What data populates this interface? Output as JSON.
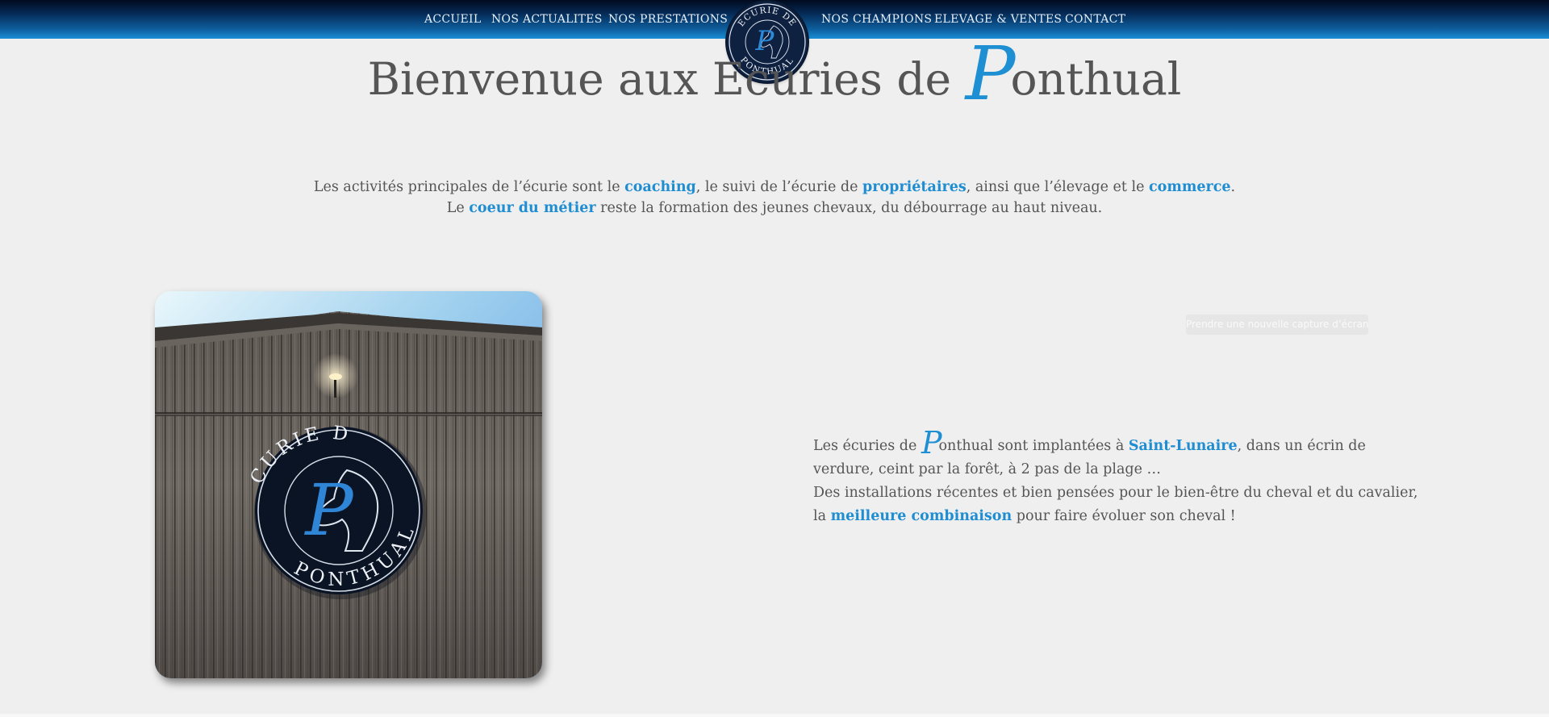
{
  "nav": {
    "items": [
      {
        "label": "ACCUEIL"
      },
      {
        "label": "NOS ACTUALITES"
      },
      {
        "label": "NOS PRESTATIONS"
      },
      {
        "label": "NOS CHAMPIONS"
      },
      {
        "label": "ELEVAGE & VENTES"
      },
      {
        "label": "CONTACT"
      }
    ],
    "logo": {
      "top_text": "ECURIE DE",
      "bottom_text": "PONTHUAL",
      "letter": "P",
      "icon": "horse-head-icon"
    }
  },
  "hero": {
    "before": "Bienvenue aux Ecuries de ",
    "script_letter": "P",
    "after": "onthual"
  },
  "intro": {
    "l1_a": "Les activités principales de l’écurie sont le ",
    "l1_b": "coaching",
    "l1_c": ", le suivi de l’écurie de ",
    "l1_d": "propriétaires",
    "l1_e": ", ainsi que l’élevage et le ",
    "l1_f": "commerce",
    "l1_g": ".",
    "l2_a": "Le ",
    "l2_b": "coeur du métier",
    "l2_c": " reste la formation des jeunes chevaux, du débourrage au haut niveau."
  },
  "photo": {
    "sign_top": "ECURIE DE",
    "sign_bottom": "PONTHUAL",
    "sign_letter": "P"
  },
  "capture_button": "Prendre une nouvelle capture d’écran",
  "description": {
    "a": "Les écuries de ",
    "script_letter": "P",
    "b": "onthual sont implantées à ",
    "c": "Saint-Lunaire",
    "d": ", dans un écrin de verdure, ceint par la forêt, à 2 pas de la plage …",
    "e": "Des installations récentes et bien pensées pour le bien-être du cheval et du cavalier, la ",
    "f": "meilleure combinaison",
    "g": " pour faire évoluer son cheval !"
  },
  "colors": {
    "accent": "#1f8dd2",
    "nav_dark": "#010a1e",
    "nav_light": "#1a8fd6",
    "background": "#efefef",
    "text": "#555555"
  }
}
